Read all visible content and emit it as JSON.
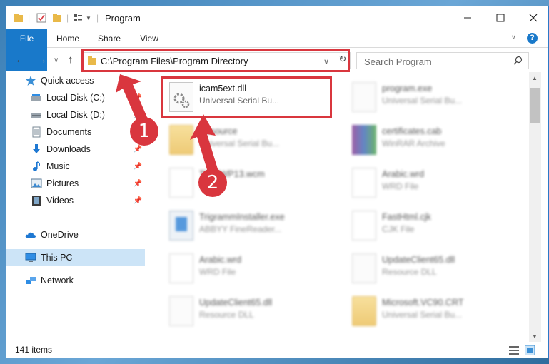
{
  "window": {
    "title": "Program"
  },
  "ribbon": {
    "tabs": [
      "File",
      "Home",
      "Share",
      "View"
    ]
  },
  "address": {
    "path": "C:\\Program Files\\Program Directory"
  },
  "search": {
    "placeholder": "Search Program"
  },
  "sidebar": {
    "items": [
      {
        "label": "Quick access"
      },
      {
        "label": "Local Disk (C:)"
      },
      {
        "label": "Local Disk (D:)"
      },
      {
        "label": "Documents"
      },
      {
        "label": "Downloads"
      },
      {
        "label": "Music"
      },
      {
        "label": "Pictures"
      },
      {
        "label": "Videos"
      },
      {
        "label": "OneDrive"
      },
      {
        "label": "This PC"
      },
      {
        "label": "Network"
      }
    ]
  },
  "files": [
    {
      "name": "icam5ext.dll",
      "type": "Universal Serial Bu..."
    },
    {
      "name": "program.exe",
      "type": "Universal Serial Bu..."
    },
    {
      "name": "Resource",
      "type": "Universal Serial Bu..."
    },
    {
      "name": "certificates.cab",
      "type": "WinRAR Archive"
    },
    {
      "name": "Th.../WP13.wcm",
      "type": "...le"
    },
    {
      "name": "Arabic.wrd",
      "type": "WRD File"
    },
    {
      "name": "TrigrammInstaller.exe",
      "type": "ABBYY FineReader..."
    },
    {
      "name": "FastHtml.cjk",
      "type": "CJK File"
    },
    {
      "name": "Arabic.wrd",
      "type": "WRD File"
    },
    {
      "name": "UpdateClient65.dll",
      "type": "Resource DLL"
    },
    {
      "name": "UpdateClient65.dll",
      "type": "Resource DLL"
    },
    {
      "name": "Microsoft.VC90.CRT",
      "type": "Universal Serial Bu..."
    }
  ],
  "status": {
    "count": "141 items"
  },
  "annotations": {
    "badge1": "1",
    "badge2": "2"
  },
  "colors": {
    "accent": "#1979ca",
    "annotation": "#d9363e",
    "selected": "#cce4f7"
  }
}
